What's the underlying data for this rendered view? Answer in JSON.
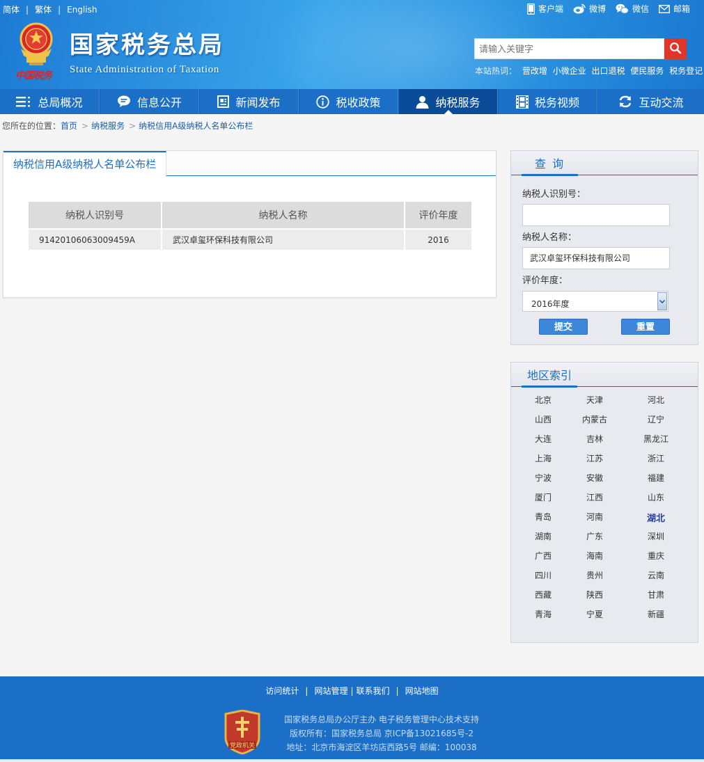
{
  "header": {
    "lang_links": [
      "简体",
      "繁体",
      "English"
    ],
    "top_links": [
      "客户端",
      "微博",
      "微信",
      "邮箱"
    ],
    "site_title": "国家税务总局",
    "site_subtitle": "State Administration of Taxation",
    "seal_text": "中国税务",
    "search_placeholder": "请输入关键字",
    "hotwords_label": "本站热词：",
    "hotwords": [
      "营改增",
      "小微企业",
      "出口退税",
      "便民服务",
      "税务登记"
    ]
  },
  "nav": {
    "items": [
      "总局概况",
      "信息公开",
      "新闻发布",
      "税收政策",
      "纳税服务",
      "税务视频",
      "互动交流"
    ],
    "active": "纳税服务"
  },
  "breadcrumb": {
    "prefix": "您所在的位置：",
    "items": [
      "首页",
      "纳税服务",
      "纳税信用A级纳税人名单公布栏"
    ]
  },
  "main": {
    "tab_title": "纳税信用A级纳税人名单公布栏",
    "table": {
      "headers": [
        "纳税人识别号",
        "纳税人名称",
        "评价年度"
      ],
      "rows": [
        [
          "91420106063009459A",
          "武汉卓玺环保科技有限公司",
          "2016"
        ]
      ]
    }
  },
  "query": {
    "title": "查 询",
    "id_label": "纳税人识别号：",
    "id_value": "",
    "name_label": "纳税人名称：",
    "name_value": "武汉卓玺环保科技有限公司",
    "year_label": "评价年度：",
    "year_value": "2016年度",
    "submit_label": "提交",
    "reset_label": "重置"
  },
  "region": {
    "title": "地区索引",
    "selected": "湖北",
    "items": [
      "北京",
      "天津",
      "河北",
      "山西",
      "内蒙古",
      "辽宁",
      "大连",
      "吉林",
      "黑龙江",
      "上海",
      "江苏",
      "浙江",
      "宁波",
      "安徽",
      "福建",
      "厦门",
      "江西",
      "山东",
      "青岛",
      "河南",
      "湖北",
      "湖南",
      "广东",
      "深圳",
      "广西",
      "海南",
      "重庆",
      "四川",
      "贵州",
      "云南",
      "西藏",
      "陕西",
      "甘肃",
      "青海",
      "宁夏",
      "新疆"
    ]
  },
  "footer": {
    "links": [
      "访问统计",
      "网站管理",
      "联系我们",
      "网站地图"
    ],
    "badge_text": "党政机关",
    "lines": [
      "国家税务总局办公厅主办 电子税务管理中心技术支持",
      "版权所有：国家税务总局 京ICP备13021685号-2",
      "地址：北京市海淀区羊坊店西路5号 邮编：100038"
    ]
  },
  "colors": {
    "brand_blue": "#1b6fc7",
    "nav_active": "#0a4c98",
    "search_red": "#e0362a",
    "region_highlight": "#1e3ea0"
  }
}
